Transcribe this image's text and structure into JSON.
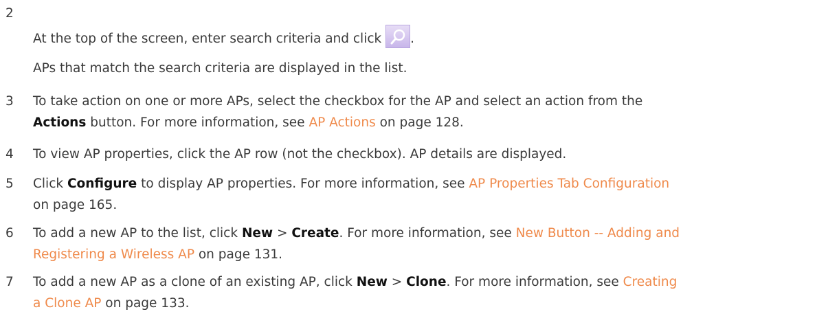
{
  "steps": [
    {
      "num": "2",
      "line1_pre": "At the top of the screen, enter search criteria and click",
      "line1_post": ".",
      "line2": "APs that match the search criteria are displayed in the list."
    },
    {
      "num": "3",
      "t1": "To take action on one or more APs, select the checkbox for the AP and select an action from the",
      "b1": "Actions",
      "t2": " button. For more information, see ",
      "link": "AP Actions",
      "t3": " on page 128."
    },
    {
      "num": "4",
      "t1": "To view AP properties, click the AP row (not the checkbox). AP details are displayed."
    },
    {
      "num": "5",
      "t1": "Click ",
      "b1": "Configure",
      "t2": " to display AP properties. For more information, see ",
      "link": "AP Properties Tab Configuration",
      "t3": "on page 165."
    },
    {
      "num": "6",
      "t1": "To add a new AP to the list, click ",
      "b1": "New",
      "t2": " > ",
      "b2": "Create",
      "t3": ". For more information, see ",
      "link1": "New Button -- Adding and",
      "link2": "Registering a Wireless AP",
      "t4": " on page 131."
    },
    {
      "num": "7",
      "t1": "To add a new AP as a clone of an existing AP, click ",
      "b1": "New",
      "t2": " > ",
      "b2": "Clone",
      "t3": ". For more information, see ",
      "link1": "Creating",
      "link2": "a Clone AP",
      "t4": " on page 133."
    }
  ],
  "icons": {
    "search": "magnifier-icon"
  },
  "colors": {
    "text": "#3a3a3a",
    "link": "#ef8a4b",
    "button_bg": "#d4c6ef"
  }
}
